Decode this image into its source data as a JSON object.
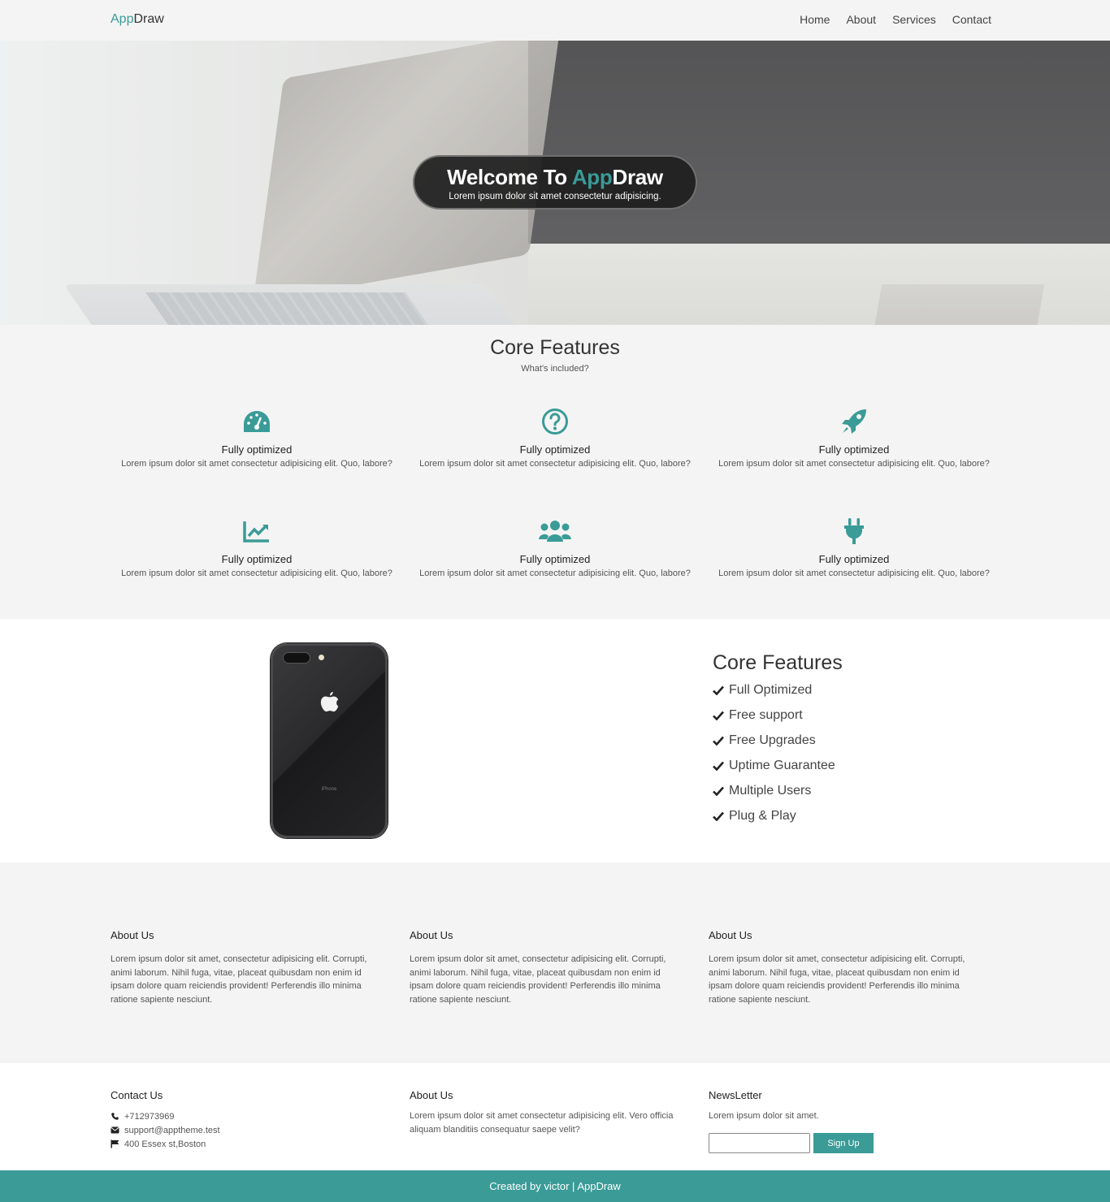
{
  "navbar": {
    "brand_accent": "App",
    "brand_rest": "Draw",
    "links": [
      "Home",
      "About",
      "Services",
      "Contact"
    ]
  },
  "hero": {
    "title_prefix": "Welcome To ",
    "title_accent": "App",
    "title_rest": "Draw",
    "subtitle": "Lorem ipsum dolor sit amet consectetur adipisicing."
  },
  "features": {
    "title": "Core Features",
    "subtitle": "What's included?",
    "items": [
      {
        "icon": "speedometer-icon",
        "title": "Fully optimized",
        "text": "Lorem ipsum dolor sit amet consectetur adipisicing elit. Quo, labore?"
      },
      {
        "icon": "question-circle-icon",
        "title": "Fully optimized",
        "text": "Lorem ipsum dolor sit amet consectetur adipisicing elit. Quo, labore?"
      },
      {
        "icon": "rocket-icon",
        "title": "Fully optimized",
        "text": "Lorem ipsum dolor sit amet consectetur adipisicing elit. Quo, labore?"
      },
      {
        "icon": "chart-line-icon",
        "title": "Fully optimized",
        "text": "Lorem ipsum dolor sit amet consectetur adipisicing elit. Quo, labore?"
      },
      {
        "icon": "users-icon",
        "title": "Fully optimized",
        "text": "Lorem ipsum dolor sit amet consectetur adipisicing elit. Quo, labore?"
      },
      {
        "icon": "plug-icon",
        "title": "Fully optimized",
        "text": "Lorem ipsum dolor sit amet consectetur adipisicing elit. Quo, labore?"
      }
    ]
  },
  "showcase": {
    "phone_model": "iPhone",
    "title": "Core Features",
    "items": [
      "Full Optimized",
      "Free support",
      "Free Upgrades",
      "Uptime Guarantee",
      "Multiple Users",
      "Plug & Play"
    ]
  },
  "about": {
    "columns": [
      {
        "title": "About Us",
        "text": "Lorem ipsum dolor sit amet, consectetur adipisicing elit. Corrupti, animi laborum. Nihil fuga, vitae, placeat quibusdam non enim id ipsam dolore quam reiciendis provident! Perferendis illo minima ratione sapiente nesciunt."
      },
      {
        "title": "About Us",
        "text": "Lorem ipsum dolor sit amet, consectetur adipisicing elit. Corrupti, animi laborum. Nihil fuga, vitae, placeat quibusdam non enim id ipsam dolore quam reiciendis provident! Perferendis illo minima ratione sapiente nesciunt."
      },
      {
        "title": "About Us",
        "text": "Lorem ipsum dolor sit amet, consectetur adipisicing elit. Corrupti, animi laborum. Nihil fuga, vitae, placeat quibusdam non enim id ipsam dolore quam reiciendis provident! Perferendis illo minima ratione sapiente nesciunt."
      }
    ]
  },
  "info": {
    "contact": {
      "title": "Contact Us",
      "phone": "+712973969",
      "email": "support@apptheme.test",
      "address": "400 Essex st,Boston"
    },
    "about": {
      "title": "About Us",
      "text": "Lorem ipsum dolor sit amet consectetur adipisicing elit. Vero officia aliquam blanditiis consequatur saepe velit?"
    },
    "newsletter": {
      "title": "NewsLetter",
      "text": "Lorem ipsum dolor sit amet.",
      "input_value": "",
      "button": "Sign Up"
    }
  },
  "footer": {
    "credit": "Created by victor | AppDraw"
  },
  "colors": {
    "accent": "#3a9b97",
    "hero_pill": "#1e1e1e",
    "background": "#f4f4f4"
  }
}
